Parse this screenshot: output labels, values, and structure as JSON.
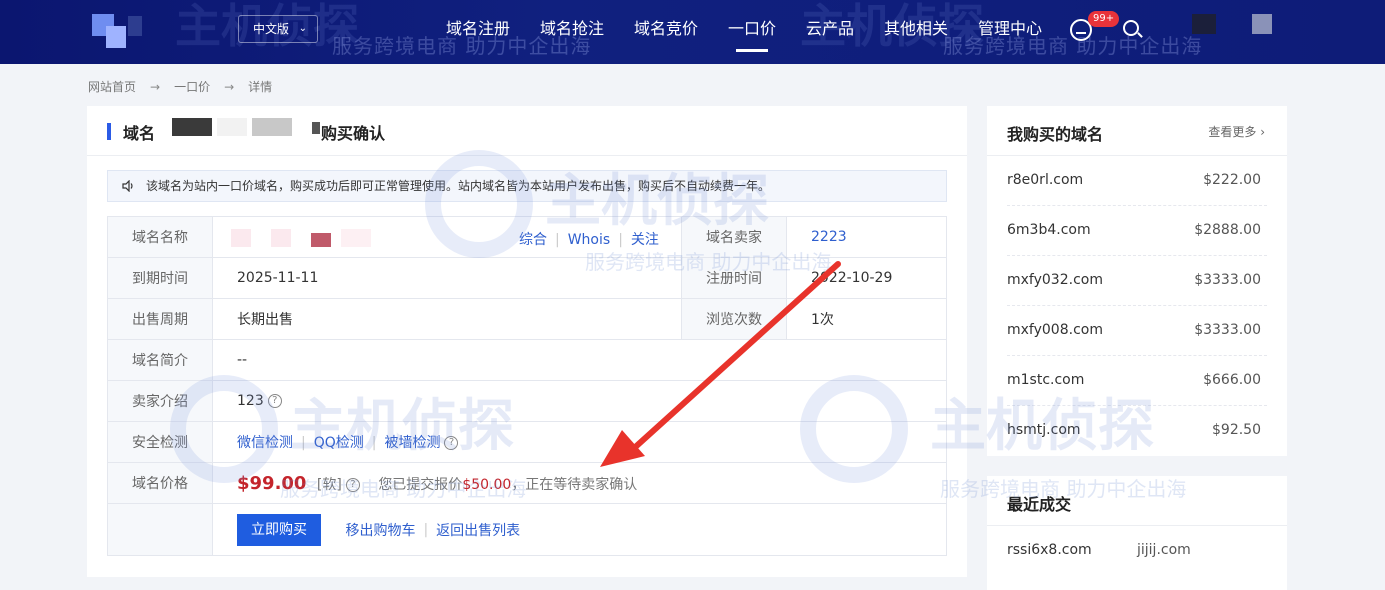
{
  "header": {
    "lang": "中文版",
    "nav": [
      "域名注册",
      "域名抢注",
      "域名竞价",
      "一口价",
      "云产品",
      "其他相关",
      "管理中心"
    ],
    "active_index": 3,
    "badge": "99+",
    "watermark": "服务跨境电商 助力中企出海"
  },
  "breadcrumb": [
    "网站首页",
    "一口价",
    "详情"
  ],
  "card": {
    "title_prefix": "域名",
    "title_suffix": "购买确认",
    "notice": "该域名为站内一口价域名，购买成功后即可正常管理使用。站内域名皆为本站用户发布出售，购买后不自动续费一年。",
    "rows": {
      "domain_label": "域名名称",
      "links": [
        "综合",
        "Whois",
        "关注"
      ],
      "seller_label": "域名卖家",
      "seller_value": "2223",
      "expire_label": "到期时间",
      "expire_value": "2025-11-11",
      "reg_label": "注册时间",
      "reg_value": "2022-10-29",
      "period_label": "出售周期",
      "period_value": "长期出售",
      "views_label": "浏览次数",
      "views_value": "1次",
      "intro_label": "域名简介",
      "intro_value": "--",
      "seller_intro_label": "卖家介绍",
      "seller_intro_value": "123",
      "security_label": "安全检测",
      "security_links": [
        "微信检测",
        "QQ检测",
        "被墙检测"
      ],
      "price_label": "域名价格",
      "price_value": "$99.00",
      "price_tag": "[软]",
      "offer_text_1": "您已提交报价",
      "offer_amount": "$50.00",
      "offer_text_2": "，正在等待卖家确认"
    },
    "buttons": {
      "buy": "立即购买",
      "remove_cart": "移出购物车",
      "back": "返回出售列表"
    }
  },
  "my_domains": {
    "title": "我购买的域名",
    "more": "查看更多",
    "items": [
      {
        "domain": "r8e0rl.com",
        "price": "$222.00"
      },
      {
        "domain": "6m3b4.com",
        "price": "$2888.00"
      },
      {
        "domain": "mxfy032.com",
        "price": "$3333.00"
      },
      {
        "domain": "mxfy008.com",
        "price": "$3333.00"
      },
      {
        "domain": "m1stc.com",
        "price": "$666.00"
      },
      {
        "domain": "hsmtj.com",
        "price": "$92.50"
      }
    ]
  },
  "recent": {
    "title": "最近成交",
    "items": [
      {
        "domain": "rssi6x8.com",
        "other": "jijij.com"
      }
    ]
  },
  "watermark": {
    "brand": "主机侦探",
    "slogan": "服务跨境电商 助力中企出海"
  },
  "colors": {
    "header_bg": "#0e1c78",
    "accent": "#1f5de0",
    "price": "#c4242b",
    "arrow": "#e8332b"
  }
}
